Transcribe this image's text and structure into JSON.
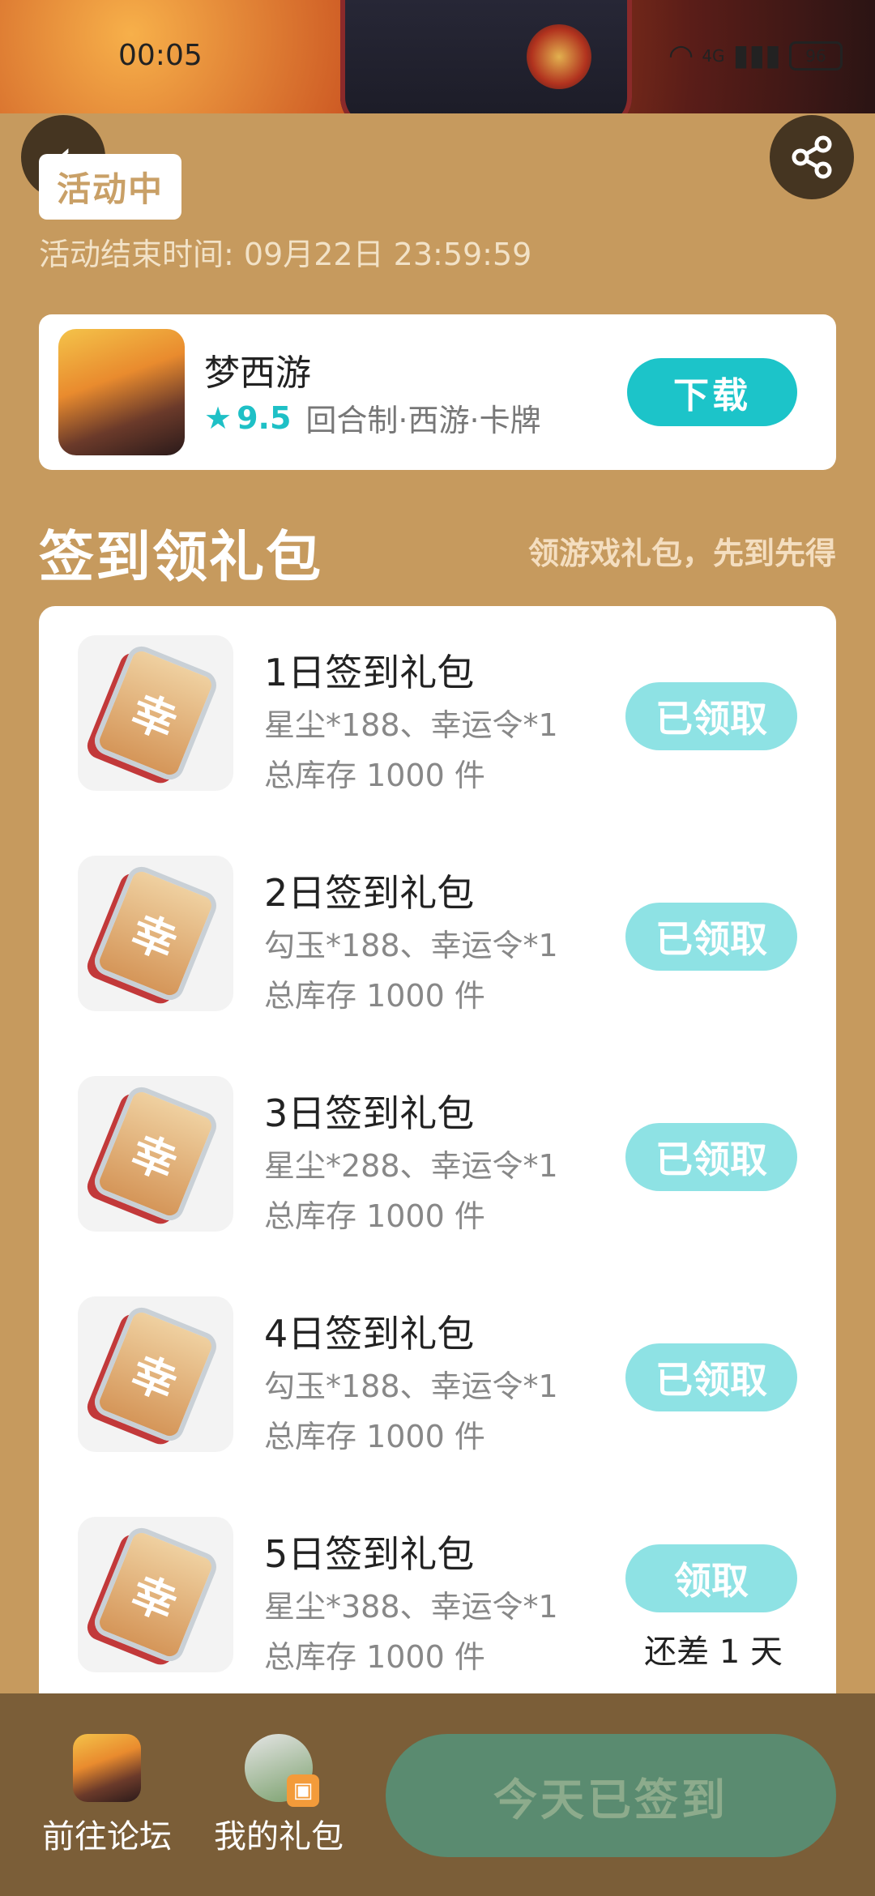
{
  "statusbar": {
    "time": "00:05",
    "network": "4G",
    "battery": "96"
  },
  "header": {
    "status_badge": "活动中",
    "end_time": "活动结束时间: 09月22日 23:59:59"
  },
  "game": {
    "name": "梦西游",
    "rating": "9.5",
    "tags": "回合制·西游·卡牌",
    "download_label": "下载"
  },
  "section": {
    "title": "签到领礼包",
    "hint": "领游戏礼包，先到先得"
  },
  "gifts": [
    {
      "name": "1日签到礼包",
      "desc": "星尘*188、幸运令*1",
      "stock": "总库存 1000 件",
      "button": "已领取",
      "note": ""
    },
    {
      "name": "2日签到礼包",
      "desc": "勾玉*188、幸运令*1",
      "stock": "总库存 1000 件",
      "button": "已领取",
      "note": ""
    },
    {
      "name": "3日签到礼包",
      "desc": "星尘*288、幸运令*1",
      "stock": "总库存 1000 件",
      "button": "已领取",
      "note": ""
    },
    {
      "name": "4日签到礼包",
      "desc": "勾玉*188、幸运令*1",
      "stock": "总库存 1000 件",
      "button": "已领取",
      "note": ""
    },
    {
      "name": "5日签到礼包",
      "desc": "星尘*388、幸运令*1",
      "stock": "总库存 1000 件",
      "button": "领取",
      "note": "还差 1 天"
    }
  ],
  "bottom": {
    "forum_label": "前往论坛",
    "my_gifts_label": "我的礼包",
    "checkin_label": "今天已签到"
  },
  "colors": {
    "accent": "#1cc4c9",
    "background": "#c69a5e",
    "claimed": "#8ee2e4",
    "checkin": "#5a8b70"
  }
}
